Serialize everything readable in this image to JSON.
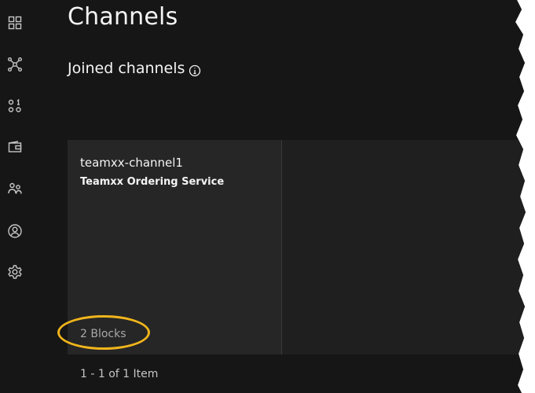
{
  "sidebar": {
    "items": [
      {
        "name": "dashboard-icon",
        "label": "Dashboard"
      },
      {
        "name": "network-icon",
        "label": "Nodes"
      },
      {
        "name": "organizations-icon",
        "label": "Organizations"
      },
      {
        "name": "wallet-icon",
        "label": "Wallet"
      },
      {
        "name": "users-icon",
        "label": "Users"
      },
      {
        "name": "profile-icon",
        "label": "Profile"
      },
      {
        "name": "settings-icon",
        "label": "Settings"
      }
    ]
  },
  "header": {
    "title": "Channels"
  },
  "section": {
    "title": "Joined channels",
    "info_icon": "information-icon"
  },
  "channels": [
    {
      "name": "teamxx-channel1",
      "ordering_service": "Teamxx Ordering Service",
      "blocks": "2 Blocks"
    }
  ],
  "pagination": {
    "text": "1 - 1 of 1 Item"
  },
  "colors": {
    "background": "#161616",
    "tile": "#262626",
    "highlight": "#f1b51c",
    "text_primary": "#f4f4f4",
    "text_secondary": "#a8a8a8"
  }
}
